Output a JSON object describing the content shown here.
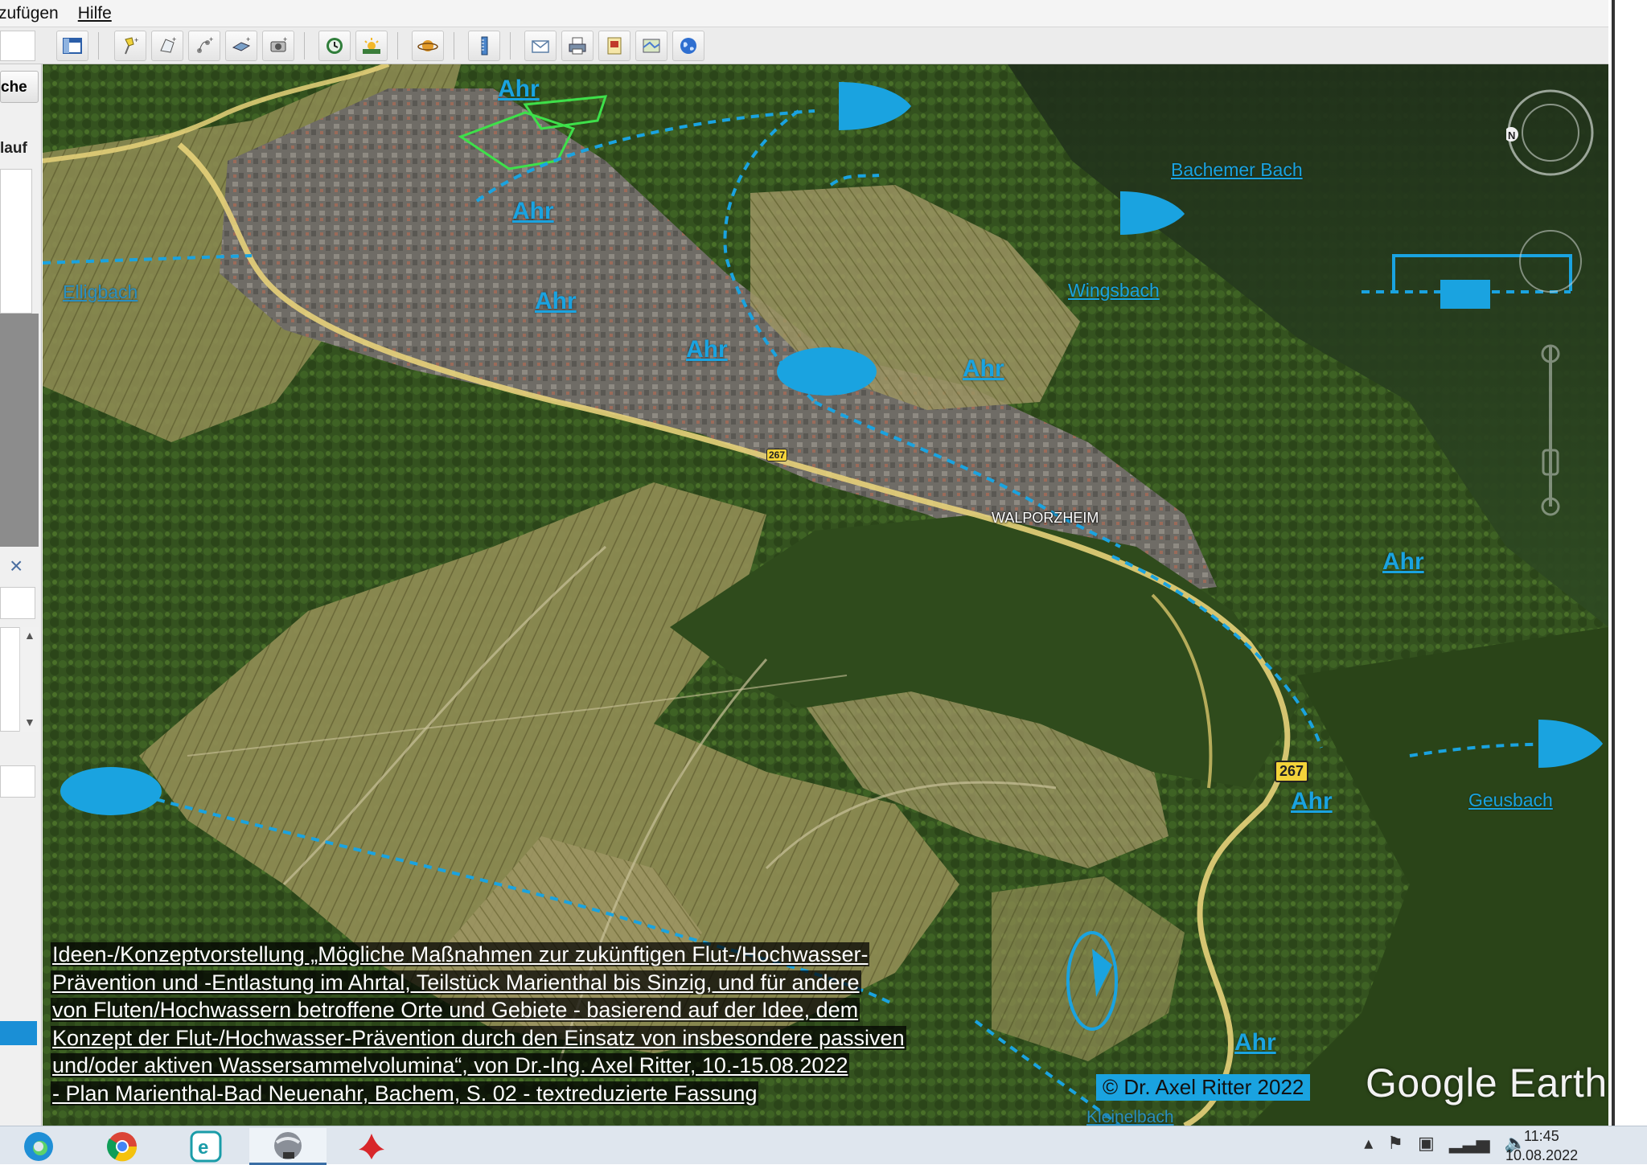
{
  "menubar": {
    "items": [
      "zufügen",
      "Hilfe"
    ]
  },
  "sidebar": {
    "search_label": "che",
    "history_label": "lauf",
    "close_glyph": "×"
  },
  "map": {
    "river_labels": [
      "Ahr",
      "Ahr",
      "Ahr",
      "Ahr",
      "Ahr",
      "Ahr",
      "Ahr",
      "Ahr"
    ],
    "stream_labels": {
      "bachemer": "Bachemer Bach",
      "wingsbach": "Wingsbach",
      "ellig": "Elligbach",
      "geusbach": "Geusbach",
      "klein": "Kleinelbach"
    },
    "town": "WALPORZHEIM",
    "road_number": "267",
    "road_number_2": "267",
    "caption_lines": [
      "Ideen-/Konzeptvorstellung „Mögliche Maßnahmen zur zukünftigen Flut-/Hochwasser-",
      "Prävention und -Entlastung im Ahrtal, Teilstück Marienthal bis Sinzig, und für andere",
      "von Fluten/Hochwassern betroffene Orte und Gebiete - basierend auf der Idee, dem",
      "Konzept der Flut-/Hochwasser-Prävention durch den Einsatz von insbesondere passiven",
      "und/oder aktiven Wassersammelvolumina“, von Dr.-Ing. Axel Ritter, 10.-15.08.2022",
      "- Plan Marienthal-Bad Neuenahr, Bachem, S. 02 - textreduzierte Fassung"
    ],
    "copyright": "© Dr. Axel Ritter 2022",
    "brand": "Google Earth",
    "north_letter": "N",
    "overlay_color": "#1aa3e0"
  },
  "taskbar": {
    "time": "11:45",
    "date": "10.08.2022"
  }
}
